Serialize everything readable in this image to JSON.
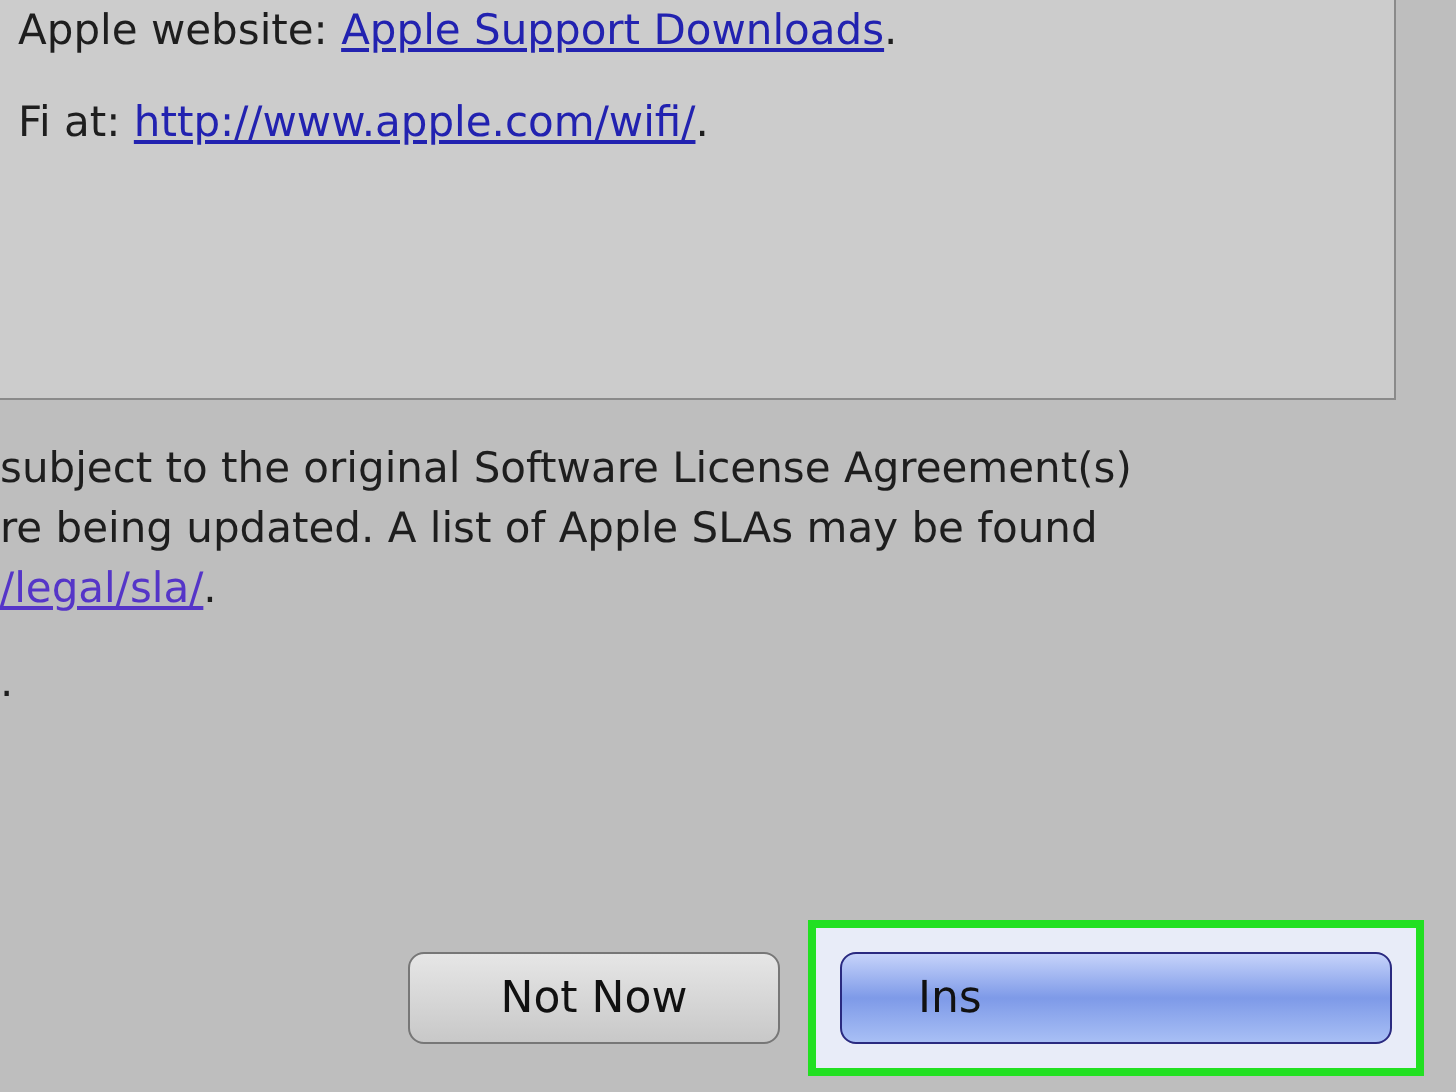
{
  "license_box": {
    "lines": [
      {
        "parts": [
          {
            "kind": "text",
            "text": "Apple website: "
          },
          {
            "kind": "link",
            "text": "Apple Support Downloads",
            "visited": false
          },
          {
            "kind": "text",
            "text": "."
          }
        ]
      },
      {
        "parts": [
          {
            "kind": "text",
            "text": "Fi at: "
          },
          {
            "kind": "link",
            "text": "http://www.apple.com/wifi/",
            "visited": false
          },
          {
            "kind": "text",
            "text": "."
          }
        ]
      }
    ]
  },
  "notice": {
    "lines": [
      {
        "parts": [
          {
            "kind": "text",
            "text": "subject to the original Software License Agreement(s)"
          }
        ]
      },
      {
        "parts": [
          {
            "kind": "text",
            "text": "re being updated. A list of Apple SLAs may be found"
          }
        ]
      },
      {
        "parts": [
          {
            "kind": "link",
            "text": "/legal/sla/",
            "visited": true
          },
          {
            "kind": "text",
            "text": "."
          }
        ]
      },
      {
        "parts": [
          {
            "kind": "text",
            "text": "."
          }
        ]
      }
    ]
  },
  "buttons": [
    {
      "label": "Not Now",
      "default": false,
      "highlighted": false
    },
    {
      "label": "Ins",
      "default": true,
      "highlighted": true
    }
  ]
}
